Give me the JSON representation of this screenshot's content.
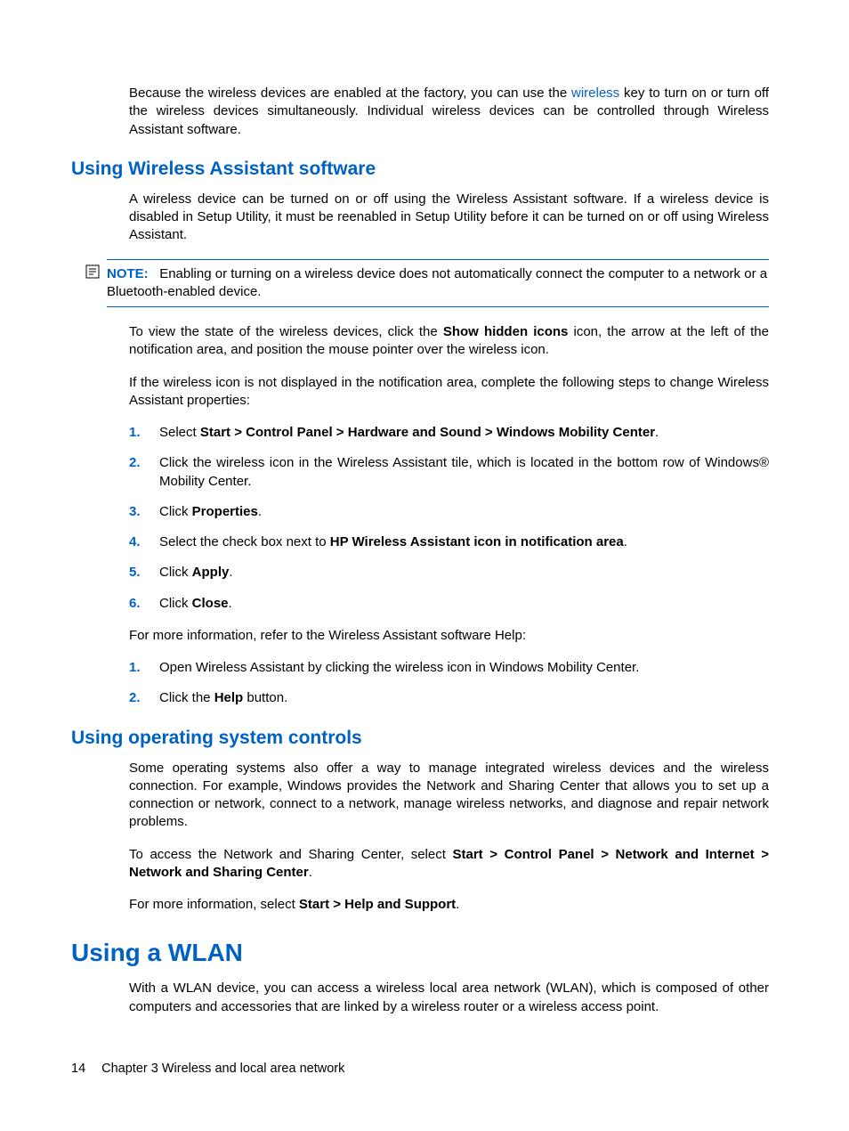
{
  "intro": {
    "p1_a": "Because the wireless devices are enabled at the factory, you can use the ",
    "p1_link": "wireless",
    "p1_b": " key to turn on or turn off the wireless devices simultaneously. Individual wireless devices can be controlled through Wireless Assistant software."
  },
  "section1": {
    "heading": "Using Wireless Assistant software",
    "p1": "A wireless device can be turned on or off using the Wireless Assistant software. If a wireless device is disabled in Setup Utility, it must be reenabled in Setup Utility before it can be turned on or off using Wireless Assistant.",
    "note_label": "NOTE:",
    "note_text": "Enabling or turning on a wireless device does not automatically connect the computer to a network or a Bluetooth-enabled device.",
    "p2_a": "To view the state of the wireless devices, click the ",
    "p2_b": "Show hidden icons",
    "p2_c": " icon, the arrow at the left of the notification area, and position the mouse pointer over the wireless icon.",
    "p3": "If the wireless icon is not displayed in the notification area, complete the following steps to change Wireless Assistant properties:",
    "steps": [
      {
        "num": "1.",
        "pre": "Select ",
        "bold": "Start > Control Panel > Hardware and Sound > Windows Mobility Center",
        "post": "."
      },
      {
        "num": "2.",
        "pre": "Click the wireless icon in the Wireless Assistant tile, which is located in the bottom row of Windows® Mobility Center.",
        "bold": "",
        "post": ""
      },
      {
        "num": "3.",
        "pre": "Click ",
        "bold": "Properties",
        "post": "."
      },
      {
        "num": "4.",
        "pre": "Select the check box next to ",
        "bold": "HP Wireless Assistant icon in notification area",
        "post": "."
      },
      {
        "num": "5.",
        "pre": "Click ",
        "bold": "Apply",
        "post": "."
      },
      {
        "num": "6.",
        "pre": "Click ",
        "bold": "Close",
        "post": "."
      }
    ],
    "p4": "For more information, refer to the Wireless Assistant software Help:",
    "steps2": [
      {
        "num": "1.",
        "pre": "Open Wireless Assistant by clicking the wireless icon in Windows Mobility Center.",
        "bold": "",
        "post": ""
      },
      {
        "num": "2.",
        "pre": "Click the ",
        "bold": "Help",
        "post": " button."
      }
    ]
  },
  "section2": {
    "heading": "Using operating system controls",
    "p1": "Some operating systems also offer a way to manage integrated wireless devices and the wireless connection. For example, Windows provides the Network and Sharing Center that allows you to set up a connection or network, connect to a network, manage wireless networks, and diagnose and repair network problems.",
    "p2_a": "To access the Network and Sharing Center, select ",
    "p2_b": "Start > Control Panel > Network and Internet > Network and Sharing Center",
    "p2_c": ".",
    "p3_a": "For more information, select ",
    "p3_b": "Start > Help and Support",
    "p3_c": "."
  },
  "section3": {
    "heading": "Using a WLAN",
    "p1": "With a WLAN device, you can access a wireless local area network (WLAN), which is composed of other computers and accessories that are linked by a wireless router or a wireless access point."
  },
  "footer": {
    "page_number": "14",
    "chapter": "Chapter 3   Wireless and local area network"
  }
}
